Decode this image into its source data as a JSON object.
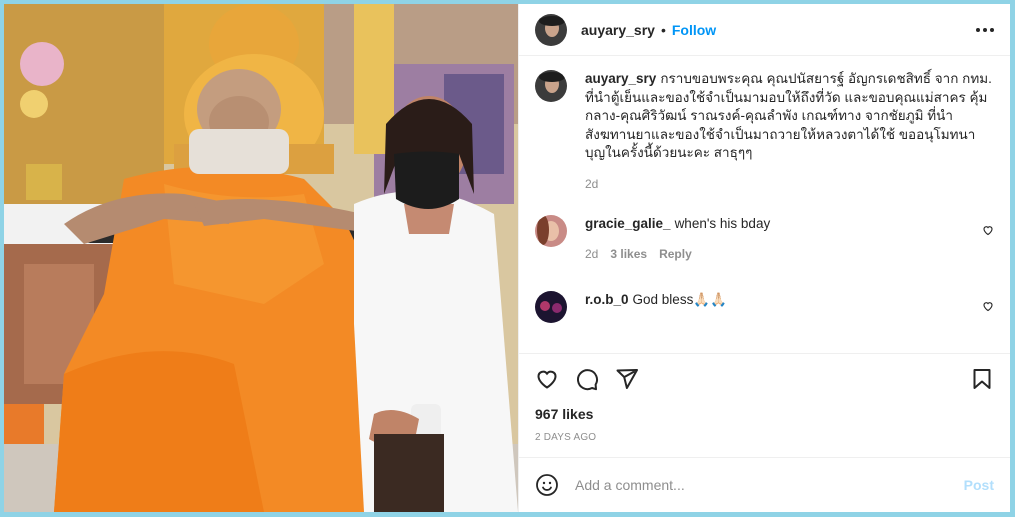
{
  "post": {
    "username": "auyary_sry",
    "separator": "•",
    "follow_label": "Follow",
    "caption_user": "auyary_sry",
    "caption_text": "กราบขอบพระคุณ คุณปนัสยารฐ์ อัญกรเดชสิทธิ์ จาก กทม. ที่นำตู้เย็นและของใช้จำเป็นมามอบให้ถึงที่วัด และขอบคุณแม่สาคร คุ้มกลาง-คุณศิริวัฒน์ ราณรงค์-คุณลำพัง เกณฑ์ทาง จากชัยภูมิ ที่นำสังฆทานยาและของใช้จำเป็นมาถวายให้หลวงตาได้ใช้ ขออนุโมทนาบุญในครั้งนี้ด้วยนะคะ สาธุๆๆ",
    "caption_time": "2d"
  },
  "comments": [
    {
      "user": "gracie_galie_",
      "text": "when's his bday",
      "time": "2d",
      "likes": "3 likes",
      "reply": "Reply"
    },
    {
      "user": "r.o.b_0",
      "text": "God bless🙏🏻🙏🏻"
    }
  ],
  "footer": {
    "likes": "967 likes",
    "date": "2 DAYS AGO",
    "comment_placeholder": "Add a comment...",
    "post_label": "Post"
  },
  "icons": {
    "like": "heart-icon",
    "comment": "comment-icon",
    "share": "paper-plane-icon",
    "save": "bookmark-icon",
    "emoji": "emoji-icon",
    "more": "more-options-icon"
  },
  "colors": {
    "accent": "#0095f6",
    "post_disabled": "#b2dffc",
    "frame": "#8fd3e6"
  }
}
